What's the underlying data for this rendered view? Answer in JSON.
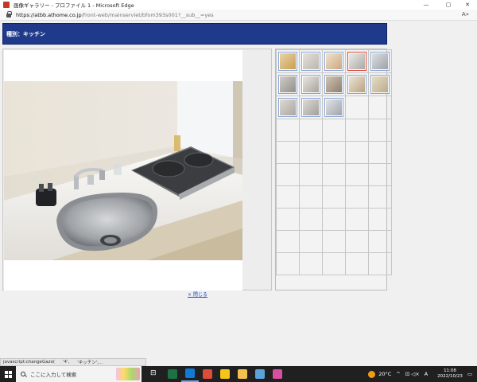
{
  "window": {
    "title": "画像ギャラリー - プロファイル 1 - Microsoft Edge",
    "min_glyph": "—",
    "max_glyph": "▢",
    "close_glyph": "✕",
    "icon": "edge-favicon-icon"
  },
  "address": {
    "url_host": "https://atbb.athome.co.jp",
    "url_path": "/front-web/mainservlet/bfom393s001?__sub__=yes",
    "reader_glyph": "A»"
  },
  "content": {
    "category_label": "種別：キッチン",
    "close_link": "× 閉じる"
  },
  "thumbnails": {
    "columns": 5,
    "rows": 10,
    "selected_index": 3,
    "items": [
      {
        "name": "thumb-exterior",
        "colors": [
          "#c99a4f",
          "#e8d8a8"
        ]
      },
      {
        "name": "thumb-room-1",
        "colors": [
          "#b9b5ac",
          "#e6e3dc"
        ]
      },
      {
        "name": "thumb-room-2",
        "colors": [
          "#caa57a",
          "#f1e5d2"
        ]
      },
      {
        "name": "thumb-kitchen",
        "colors": [
          "#a7a4a0",
          "#eeeeec"
        ]
      },
      {
        "name": "thumb-bath",
        "colors": [
          "#9a9ea3",
          "#dfe3e6"
        ]
      },
      {
        "name": "thumb-room-3",
        "colors": [
          "#8f8c86",
          "#d3d0cb"
        ]
      },
      {
        "name": "thumb-closet",
        "colors": [
          "#a49f98",
          "#ece9e4"
        ]
      },
      {
        "name": "thumb-door",
        "colors": [
          "#8a7b69",
          "#d4c8b8"
        ]
      },
      {
        "name": "thumb-entrance",
        "colors": [
          "#b69f7c",
          "#efe7da"
        ]
      },
      {
        "name": "thumb-hall",
        "colors": [
          "#b8a886",
          "#e8e0cc"
        ]
      },
      {
        "name": "thumb-room-4",
        "colors": [
          "#a8a29a",
          "#e1ddd6"
        ]
      },
      {
        "name": "thumb-washroom",
        "colors": [
          "#9f9c97",
          "#e2dfdb"
        ]
      },
      {
        "name": "thumb-view",
        "colors": [
          "#9ca0a6",
          "#e6e7e9"
        ]
      }
    ]
  },
  "status": {
    "left": "javascript:changeGazo(",
    "mid": "'4',",
    "right": "'キッチン',..."
  },
  "taskbar": {
    "search_placeholder": "ここに入力して検索",
    "apps": [
      {
        "name": "task-view-icon",
        "color": "#202020",
        "glyph": "⊟"
      },
      {
        "name": "excel-icon",
        "color": "#1e7145"
      },
      {
        "name": "edge-icon",
        "color": "#0f7bd6",
        "active": true
      },
      {
        "name": "chrome-icon",
        "color": "#dd4b39"
      },
      {
        "name": "sticky-notes-icon",
        "color": "#f5c518"
      },
      {
        "name": "file-explorer-icon",
        "color": "#f2c14e"
      },
      {
        "name": "notepad-icon",
        "color": "#5ba3d9"
      },
      {
        "name": "media-icon",
        "color": "#d6509f"
      }
    ],
    "weather": "20°C",
    "tray_chevron": "^",
    "tray_icons": "⊡ ◁×",
    "ime": "A",
    "time": "11:08",
    "date": "2022/10/23",
    "notification_glyph": "▭"
  }
}
